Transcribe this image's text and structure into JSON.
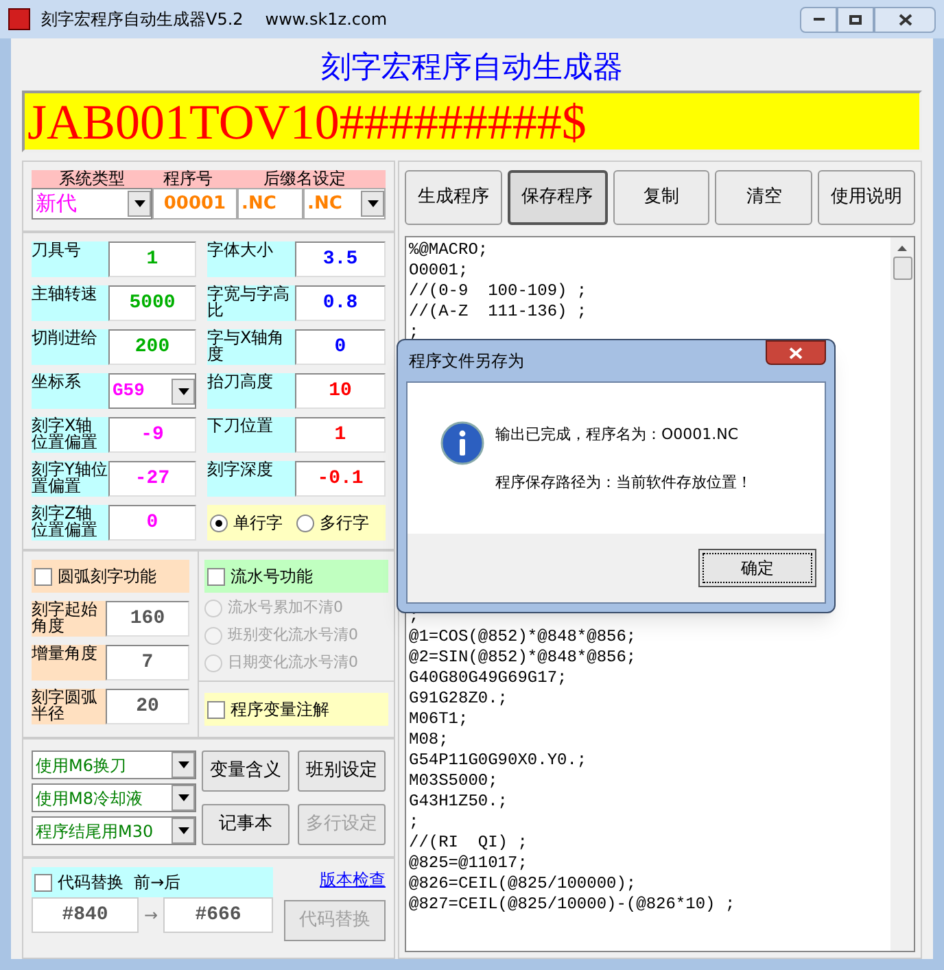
{
  "window": {
    "title": "刻字宏程序自动生成器V5.2",
    "subtitle": "www.sk1z.com"
  },
  "heading": "刻字宏程序自动生成器",
  "engrave_text": "JAB001TOV10#########$",
  "program_header": {
    "labels": [
      "系统类型",
      "程序号",
      "后缀名设定"
    ],
    "system_type": "新代",
    "program_number": "00001",
    "suffix_field": ".NC",
    "suffix_select": ".NC"
  },
  "params_left": [
    {
      "label": "刀具号",
      "value": "1",
      "kind": "field",
      "color": "#00b000"
    },
    {
      "label": "主轴转速",
      "value": "5000",
      "kind": "field",
      "color": "#00b000"
    },
    {
      "label": "切削进给",
      "value": "200",
      "kind": "field",
      "color": "#00b000"
    },
    {
      "label": "坐标系",
      "value": "G59",
      "kind": "dropdown",
      "color": "#ff00ff"
    },
    {
      "label": "刻字X轴位置偏置",
      "value": "-9",
      "kind": "field",
      "color": "#ff00ff"
    },
    {
      "label": "刻字Y轴位置偏置",
      "value": "-27",
      "kind": "field",
      "color": "#ff00ff"
    },
    {
      "label": "刻字Z轴位置偏置",
      "value": "0",
      "kind": "field",
      "color": "#ff00ff"
    }
  ],
  "params_right": [
    {
      "label": "字体大小",
      "value": "3.5",
      "color": "#0000ff"
    },
    {
      "label": "字宽与字高比",
      "value": "0.8",
      "color": "#0000ff"
    },
    {
      "label": "字与X轴角度",
      "value": "0",
      "color": "#0000ff"
    },
    {
      "label": "抬刀高度",
      "value": "10",
      "color": "#ff0000"
    },
    {
      "label": "下刀位置",
      "value": "1",
      "color": "#ff0000"
    },
    {
      "label": "刻字深度",
      "value": "-0.1",
      "color": "#ff0000"
    }
  ],
  "line_mode": [
    {
      "label": "单行字",
      "selected": true
    },
    {
      "label": "多行字",
      "selected": false
    }
  ],
  "arc": {
    "label": "圆弧刻字功能",
    "checked": false,
    "fields": [
      {
        "label": "刻字起始角度",
        "value": "160"
      },
      {
        "label": "增量角度",
        "value": "7"
      },
      {
        "label": "刻字圆弧半径",
        "value": "20"
      }
    ]
  },
  "serial": {
    "label": "流水号功能",
    "checked": false,
    "options": [
      {
        "label": "流水号累加不清0",
        "selected": false,
        "disabled": true
      },
      {
        "label": "班别变化流水号清0",
        "selected": false,
        "disabled": true
      },
      {
        "label": "日期变化流水号清0",
        "selected": false,
        "disabled": true
      }
    ]
  },
  "variable_comment": {
    "label": "程序变量注解",
    "checked": false
  },
  "dropdowns": [
    "使用M6换刀",
    "使用M8冷却液",
    "程序结尾用M30"
  ],
  "side_buttons": [
    {
      "label": "变量含义",
      "disabled": false
    },
    {
      "label": "班别设定",
      "disabled": false
    },
    {
      "label": "记事本",
      "disabled": false
    },
    {
      "label": "多行设定",
      "disabled": true
    }
  ],
  "replace": {
    "label": "代码替换  前→后",
    "checked": false,
    "link": "版本检查",
    "from": "#840",
    "arrow": "→",
    "to": "#666",
    "button": {
      "label": "代码替换",
      "disabled": true
    }
  },
  "toolbar": [
    {
      "label": "生成程序",
      "focused": false
    },
    {
      "label": "保存程序",
      "focused": true
    },
    {
      "label": "复制",
      "focused": false
    },
    {
      "label": "清空",
      "focused": false
    },
    {
      "label": "使用说明",
      "focused": false
    }
  ],
  "code_top": [
    "%@MACRO;",
    "O0001;",
    "//(0-9  100-109) ;",
    "//(A-Z  111-136) ;",
    ";"
  ],
  "code_bottom": [
    ";",
    "@1=COS(@852)*@848*@856;",
    "@2=SIN(@852)*@848*@856;",
    "G40G80G49G69G17;",
    "G91G28Z0.;",
    "M06T1;",
    "M08;",
    "G54P11G0G90X0.Y0.;",
    "M03S5000;",
    "G43H1Z50.;",
    ";",
    "//(RI  QI) ;",
    "@825=@11017;",
    "@826=CEIL(@825/100000);",
    "@827=CEIL(@825/10000)-(@826*10) ;"
  ],
  "dialog": {
    "title": "程序文件另存为",
    "message": "输出已完成，程序名为：O0001.NC",
    "detail": "程序保存路径为：当前软件存放位置！",
    "button": "确定"
  }
}
